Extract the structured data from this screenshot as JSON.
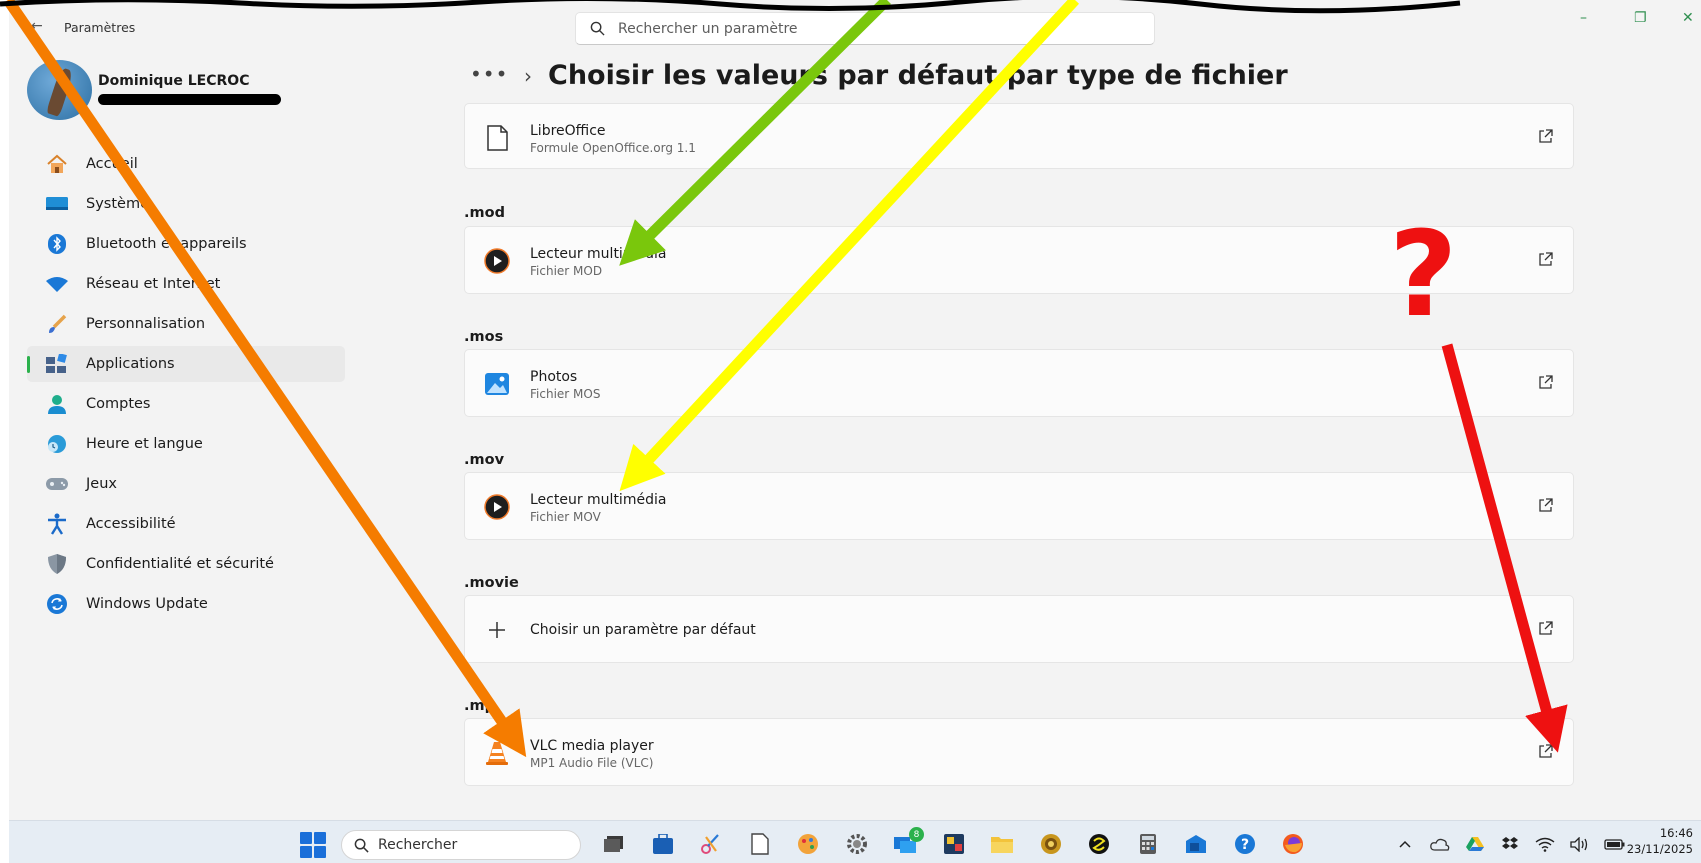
{
  "window": {
    "title": "Paramètres",
    "back_label": "←",
    "search_placeholder": "Rechercher un paramètre",
    "controls": {
      "minimize": "–",
      "maximize": "❐",
      "close": "✕"
    }
  },
  "profile": {
    "name": "Dominique LECROC"
  },
  "sidebar": {
    "items": [
      {
        "label": "Accueil",
        "icon": "home-icon"
      },
      {
        "label": "Système",
        "icon": "system-icon"
      },
      {
        "label": "Bluetooth et appareils",
        "icon": "bluetooth-icon"
      },
      {
        "label": "Réseau et Internet",
        "icon": "wifi-icon"
      },
      {
        "label": "Personnalisation",
        "icon": "brush-icon"
      },
      {
        "label": "Applications",
        "icon": "apps-icon",
        "active": true
      },
      {
        "label": "Comptes",
        "icon": "account-icon"
      },
      {
        "label": "Heure et langue",
        "icon": "time-language-icon"
      },
      {
        "label": "Jeux",
        "icon": "gamepad-icon"
      },
      {
        "label": "Accessibilité",
        "icon": "accessibility-icon"
      },
      {
        "label": "Confidentialité et sécurité",
        "icon": "shield-icon"
      },
      {
        "label": "Windows Update",
        "icon": "update-icon"
      }
    ]
  },
  "header": {
    "breadcrumb_more": "•••",
    "separator": "›",
    "title": "Choisir les valeurs par défaut par type de fichier"
  },
  "entries": [
    {
      "ext": "",
      "app": "LibreOffice",
      "desc": "Formule OpenOffice.org 1.1",
      "icon": "libreoffice-file-icon"
    },
    {
      "ext": ".mod",
      "app": "Lecteur multimédia",
      "desc": "Fichier MOD",
      "icon": "media-player-icon"
    },
    {
      "ext": ".mos",
      "app": "Photos",
      "desc": "Fichier MOS",
      "icon": "photos-icon"
    },
    {
      "ext": ".mov",
      "app": "Lecteur multimédia",
      "desc": "Fichier MOV",
      "icon": "media-player-icon"
    },
    {
      "ext": ".movie",
      "app": "Choisir un paramètre par défaut",
      "desc": "",
      "icon": "plus-icon"
    },
    {
      "ext": ".mp",
      "app": "VLC media player",
      "desc": "MP1 Audio File (VLC)",
      "icon": "vlc-icon"
    }
  ],
  "annotation": {
    "question_mark": "?",
    "colors": {
      "orange": "#f57c00",
      "green": "#7ac70c",
      "yellow": "#ffff00",
      "red": "#ee1111"
    }
  },
  "taskbar": {
    "search_label": "Rechercher",
    "badge_count": "8",
    "time": "16:46",
    "date": "23/11/2025"
  }
}
